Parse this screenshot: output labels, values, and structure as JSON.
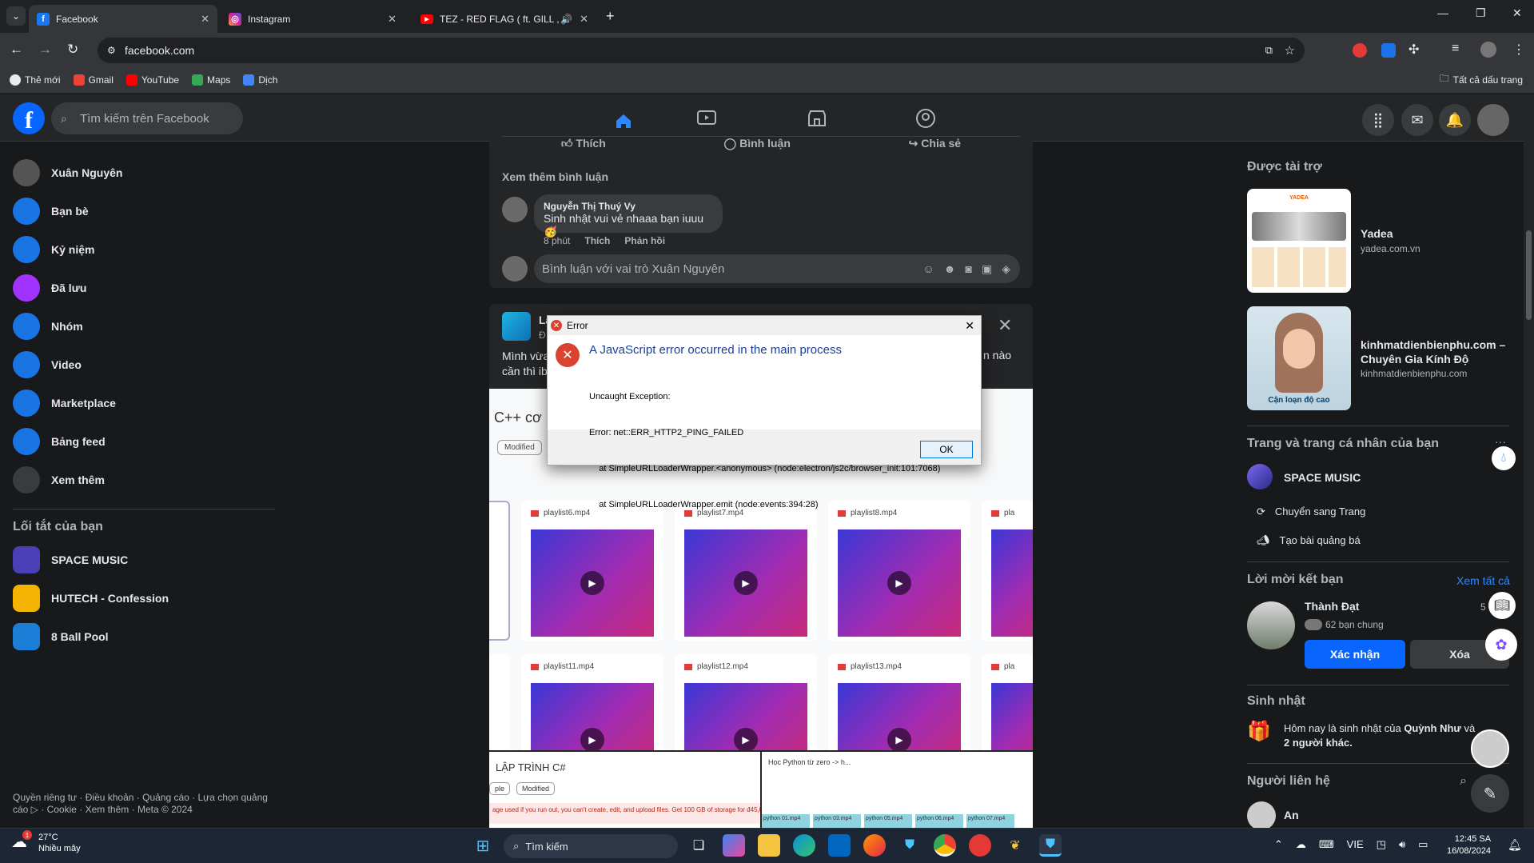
{
  "browser": {
    "tabs": [
      {
        "title": "Facebook",
        "icon": "facebook-icon",
        "color": "#1877f2"
      },
      {
        "title": "Instagram",
        "icon": "instagram-icon",
        "color": "#d6249f"
      },
      {
        "title": "TEZ - RED FLAG ( ft. GILL , I",
        "icon": "youtube-icon",
        "color": "#ff0000"
      }
    ],
    "url": "facebook.com",
    "bookmarks": [
      {
        "label": "Thẻ mới",
        "color": "#e8eaed"
      },
      {
        "label": "Gmail",
        "color": "#ea4335"
      },
      {
        "label": "YouTube",
        "color": "#ff0000"
      },
      {
        "label": "Maps",
        "color": "#34a853"
      },
      {
        "label": "Dịch",
        "color": "#4285f4"
      }
    ],
    "all_bookmarks": "Tất cả dấu trang"
  },
  "facebook": {
    "search_placeholder": "Tìm kiếm trên Facebook",
    "sidebar": [
      {
        "label": "Xuân Nguyên",
        "icon": "avatar-icon",
        "color": "#555"
      },
      {
        "label": "Bạn bè",
        "icon": "friends-icon",
        "color": "#1b74e4"
      },
      {
        "label": "Kỷ niệm",
        "icon": "clock-icon",
        "color": "#1b74e4"
      },
      {
        "label": "Đã lưu",
        "icon": "bookmark-icon",
        "color": "#a033ff"
      },
      {
        "label": "Nhóm",
        "icon": "groups-icon",
        "color": "#1b74e4"
      },
      {
        "label": "Video",
        "icon": "video-icon",
        "color": "#1b74e4"
      },
      {
        "label": "Marketplace",
        "icon": "marketplace-icon",
        "color": "#1b74e4"
      },
      {
        "label": "Bảng feed",
        "icon": "feed-icon",
        "color": "#1b74e4"
      },
      {
        "label": "Xem thêm",
        "icon": "chevron-down-icon",
        "color": "#3a3b3c"
      }
    ],
    "shortcuts_title": "Lối tắt của bạn",
    "shortcuts": [
      {
        "label": "SPACE MUSIC",
        "color": "#4b3fb8"
      },
      {
        "label": "HUTECH - Confession",
        "color": "#f5b301"
      },
      {
        "label": "8 Ball Pool",
        "color": "#1c7ed6"
      }
    ],
    "footer_line1": "Quyền riêng tư · Điều khoản · Quảng cáo · Lựa chọn quảng",
    "footer_line2": "cáo ▷ · Cookie · Xem thêm · Meta © 2024",
    "post": {
      "like": "Thích",
      "comment": "Bình luận",
      "share": "Chia sẻ",
      "more_comments": "Xem thêm bình luận",
      "comment_author": "Nguyễn Thị Thuý Vy",
      "comment_text": "Sinh nhật vui vẻ nhaaa bạn iuuu🥳",
      "comment_time": "8 phút",
      "comment_like": "Thích",
      "comment_reply": "Phản hồi",
      "compose_placeholder": "Bình luận với vai trò Xuân Nguyên"
    },
    "post2": {
      "title_partial": "Lậ",
      "sub_partial": "Đ",
      "text_partial": "Mình vừa",
      "text_partial2": "cần thì ib",
      "text_right": "n nào",
      "code_text": "C++ cơ l",
      "modified": "Modified",
      "videos_row1": [
        "playlist6.mp4",
        "playlist7.mp4",
        "playlist8.mp4",
        "pla"
      ],
      "videos_row2": [
        "playlist11.mp4",
        "playlist12.mp4",
        "playlist13.mp4",
        "pla"
      ],
      "bottom_left_title": "LẬP TRÌNH C#",
      "bottom_left_tag1": "ple",
      "bottom_left_tag2": "Modified",
      "bottom_left_notice": "age used if you run out, you can't create, edit, and upload files. Get 100 GB of storage for đ45,000 đ11,25",
      "bottom_right_title": "Học Python từ zero -> h...",
      "bottom_right_tag1": "",
      "bottom_right_files": [
        "python 01.mp4",
        "python 03.mp4",
        "python 05.mp4",
        "python 06.mp4",
        "python 07.mp4"
      ]
    },
    "right": {
      "sponsored": "Được tài trợ",
      "ads": [
        {
          "name": "Yadea",
          "domain": "yadea.com.vn",
          "caption": "YADEA"
        },
        {
          "name": "kinhmatdienbienphu.com – Chuyên Gia Kính Độ",
          "domain": "kinhmatdienbienphu.com",
          "caption": "Cận loạn độ cao"
        }
      ],
      "pages_title": "Trang và trang cá nhân của bạn",
      "page_name": "SPACE MUSIC",
      "switch_page": "Chuyển sang Trang",
      "create_ad": "Tạo bài quảng bá",
      "friend_req_title": "Lời mời kết bạn",
      "see_all": "Xem tất cả",
      "friend_name": "Thành Đạt",
      "friend_mutual": "62 bạn chung",
      "friend_time": "5",
      "confirm": "Xác nhận",
      "delete": "Xóa",
      "birthday_title": "Sinh nhật",
      "birthday_prefix": "Hôm nay là sinh nhật của ",
      "birthday_name": "Quỳnh Như",
      "birthday_suffix": " và",
      "birthday_line2": "2 người khác.",
      "contacts_title": "Người liên hệ",
      "contact1": "An"
    }
  },
  "dialog": {
    "title": "Error",
    "heading": "A JavaScript error occurred in the main process",
    "lines": [
      "Uncaught Exception:",
      "Error: net::ERR_HTTP2_PING_FAILED",
      "    at SimpleURLLoaderWrapper.<anonymous> (node:electron/js2c/browser_init:101:7068)",
      "    at SimpleURLLoaderWrapper.emit (node:events:394:28)"
    ],
    "ok": "OK"
  },
  "taskbar": {
    "weather_temp": "27°C",
    "weather_desc": "Nhiều mây",
    "weather_badge": "1",
    "search": "Tìm kiếm",
    "lang": "VIE",
    "time": "12:45 SA",
    "date": "16/08/2024"
  }
}
